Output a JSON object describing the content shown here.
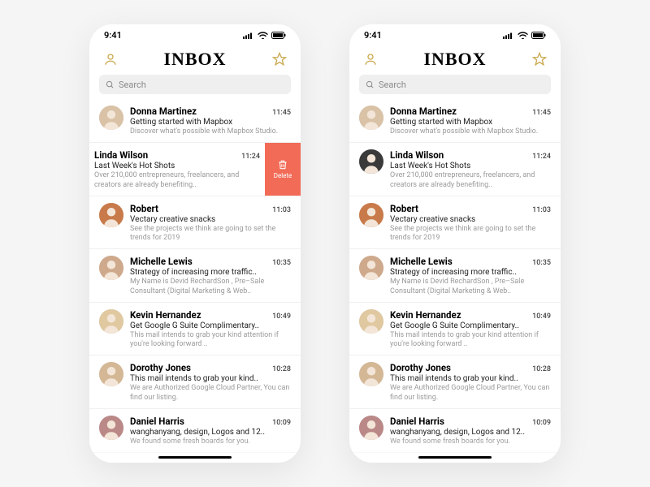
{
  "status_time": "9:41",
  "header_title": "INBOX",
  "search_placeholder": "Search",
  "delete_label": "Delete",
  "emails": [
    {
      "sender": "Donna Martinez",
      "subject": "Getting started with Mapbox",
      "preview": "Discover what's possible with Mapbox Studio.",
      "time": "11:45"
    },
    {
      "sender": "Linda Wilson",
      "subject": "Last Week's Hot Shots",
      "preview": "Over 210,000 entrepreneurs, freelancers, and creators are already benefiting..",
      "time": "11:24"
    },
    {
      "sender": "Robert",
      "subject": "Vectary creative snacks",
      "preview": "See the projects we think are going to set the trends for 2019",
      "time": "11:03"
    },
    {
      "sender": "Michelle Lewis",
      "subject": "Strategy of increasing more traffic..",
      "preview": "My Name is Devid RechardSon , Pre–Sale Consultant (Digital Marketing & Web..",
      "time": "10:35"
    },
    {
      "sender": "Kevin Hernandez",
      "subject": "Get Google G Suite Complimentary..",
      "preview": "This mail intends to grab your kind attention if you're looking forward ..",
      "time": "10:49"
    },
    {
      "sender": "Dorothy Jones",
      "subject": "This mail intends to grab your kind..",
      "preview": "We are Authorized Google Cloud Partner, You can find our listing.",
      "time": "10:28"
    },
    {
      "sender": "Daniel Harris",
      "subject": "wanghanyang, design, Logos and 12..",
      "preview": "We found some fresh boards for you.",
      "time": "10:09"
    }
  ],
  "avatar_colors": [
    "#d9c2a6",
    "#3a3a3a",
    "#c97a4a",
    "#cfa98c",
    "#e0c8a0",
    "#d4b896",
    "#b88"
  ],
  "swiped_index_left_phone": 1
}
